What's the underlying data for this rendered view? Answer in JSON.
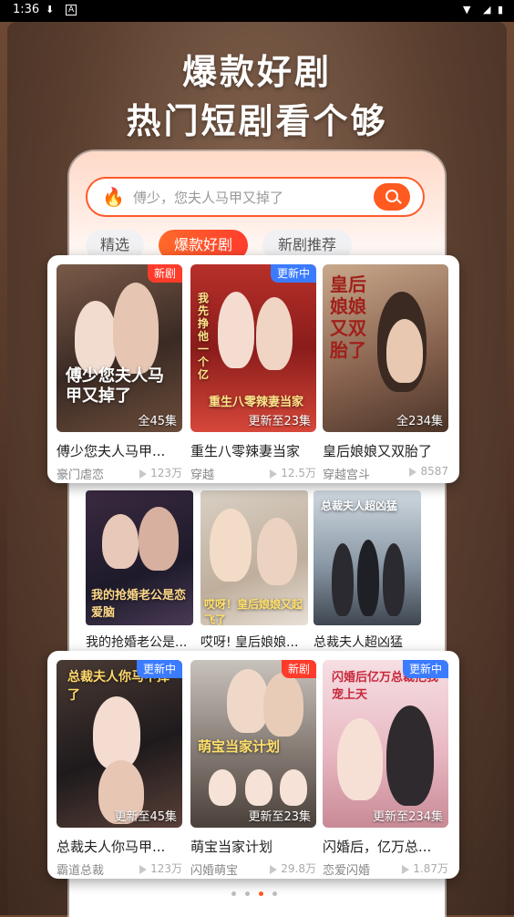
{
  "status": {
    "time": "1:36"
  },
  "headline": {
    "line1": "爆款好剧",
    "line2": "热门短剧看个够"
  },
  "search": {
    "placeholder": "傅少，您夫人马甲又掉了"
  },
  "tabs": [
    {
      "label": "精选"
    },
    {
      "label": "爆款好剧",
      "active": true
    },
    {
      "label": "新剧推荐"
    }
  ],
  "top_cards": [
    {
      "title": "傅少您夫人马甲...",
      "badge": "新剧",
      "badge_color": "#ff3b2a",
      "episodes": "全45集",
      "tag": "豪门虐恋",
      "plays": "123万",
      "poster_text": "傅少您夫人马甲又掉了"
    },
    {
      "title": "重生八零辣妻当家",
      "badge": "更新中",
      "badge_color": "#3b7bff",
      "episodes": "更新至23集",
      "tag": "穿越",
      "plays": "12.5万",
      "poster_text": "重生八零辣妻当家"
    },
    {
      "title": "皇后娘娘又双胎了",
      "badge": "",
      "badge_color": "",
      "episodes": "全234集",
      "tag": "穿越宫斗",
      "plays": "8587",
      "poster_text": "皇后娘娘又双胎了"
    }
  ],
  "middle_cards": [
    {
      "title": "我的抢婚老公是...",
      "poster_text": "我的抢婚老公是恋爱脑"
    },
    {
      "title": "哎呀! 皇后娘娘...",
      "poster_text": "哎呀！皇后娘娘又起飞了"
    },
    {
      "title": "总裁夫人超凶猛",
      "poster_text": "总裁夫人超凶猛"
    }
  ],
  "bottom_cards": [
    {
      "title": "总裁夫人你马甲...",
      "badge": "更新中",
      "badge_color": "#3b7bff",
      "episodes": "更新至45集",
      "tag": "霸道总裁",
      "plays": "123万",
      "poster_text": "总裁夫人你马甲掉了"
    },
    {
      "title": "萌宝当家计划",
      "badge": "新剧",
      "badge_color": "#ff3b2a",
      "episodes": "更新至23集",
      "tag": "闪婚萌宝",
      "plays": "29.8万",
      "poster_text": "萌宝当家计划"
    },
    {
      "title": "闪婚后，亿万总...",
      "badge": "更新中",
      "badge_color": "#3b7bff",
      "episodes": "更新至234集",
      "tag": "恋爱闪婚",
      "plays": "1.87万",
      "poster_text": "闪婚后亿万总裁把我宠上天"
    }
  ],
  "pager": {
    "count": 4,
    "active": 2
  }
}
